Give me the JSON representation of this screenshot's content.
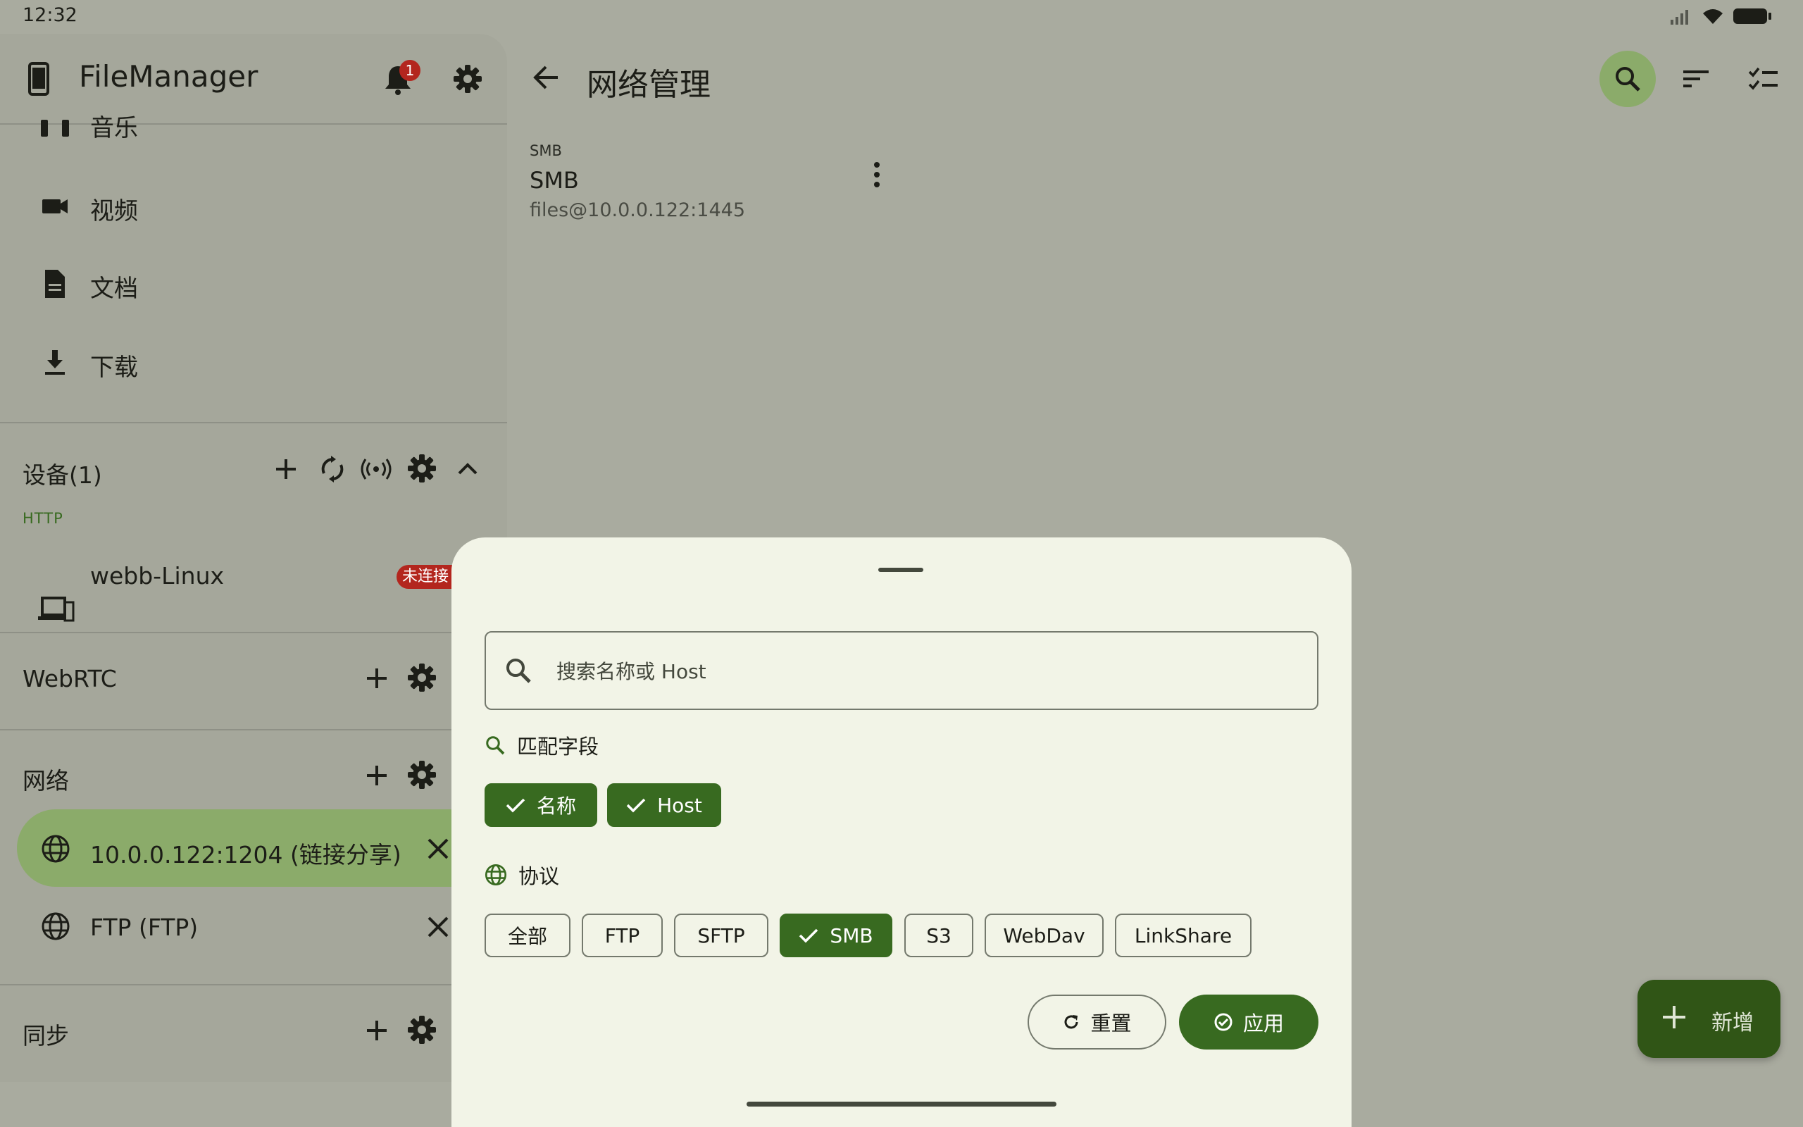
{
  "status_bar": {
    "time": "12:32"
  },
  "sidebar": {
    "app_title": "FileManager",
    "notification_count": "1",
    "nav_items": [
      {
        "label": "音乐",
        "icon": "headphones-icon"
      },
      {
        "label": "视频",
        "icon": "videocam-icon"
      },
      {
        "label": "文档",
        "icon": "document-icon"
      },
      {
        "label": "下载",
        "icon": "download-icon"
      }
    ],
    "devices": {
      "title": "设备(1)",
      "protocol": "HTTP",
      "item_label": "webb-Linux",
      "item_status": "未连接"
    },
    "webrtc": {
      "title": "WebRTC"
    },
    "network": {
      "title": "网络",
      "items": [
        {
          "label": "10.0.0.122:1204 (链接分享)"
        },
        {
          "label": "FTP (FTP)"
        }
      ]
    },
    "sync": {
      "title": "同步"
    }
  },
  "main": {
    "title": "网络管理",
    "connection": {
      "type": "SMB",
      "name": "SMB",
      "host": "files@10.0.0.122:1445"
    }
  },
  "fab": {
    "label": "新增"
  },
  "sheet": {
    "search_placeholder": "搜索名称或 Host",
    "search_value": "",
    "match_fields_title": "匹配字段",
    "match_fields": [
      {
        "label": "名称",
        "selected": true
      },
      {
        "label": "Host",
        "selected": true
      }
    ],
    "protocol_title": "协议",
    "protocols": [
      {
        "label": "全部",
        "selected": false
      },
      {
        "label": "FTP",
        "selected": false
      },
      {
        "label": "SFTP",
        "selected": false
      },
      {
        "label": "SMB",
        "selected": true
      },
      {
        "label": "S3",
        "selected": false
      },
      {
        "label": "WebDav",
        "selected": false
      },
      {
        "label": "LinkShare",
        "selected": false
      }
    ],
    "reset_label": "重置",
    "apply_label": "应用"
  },
  "colors": {
    "accent": "#386a20",
    "active_nav": "#8bab6a",
    "badge_red": "#b3261e",
    "sheet_bg": "#f2f4e7",
    "fab_bg": "#305516"
  }
}
